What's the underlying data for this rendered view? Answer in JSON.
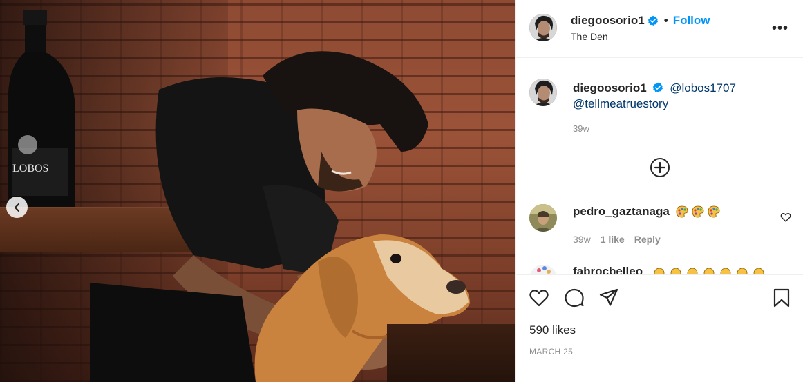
{
  "header": {
    "username": "diegoosorio1",
    "separator": "•",
    "follow_label": "Follow",
    "location": "The Den",
    "more_label": "•••",
    "verified": true
  },
  "photo": {
    "bottle_text": "LOBOS"
  },
  "caption": {
    "username": "diegoosorio1",
    "mention_1": "@lobos1707",
    "mention_2": "@tellmeatruestory",
    "time": "39w"
  },
  "comments": [
    {
      "username": "pedro_gaztanaga",
      "emoji_count": 3,
      "emoji_name": "artist-palette-icon",
      "time": "39w",
      "likes": "1 like",
      "reply_label": "Reply"
    }
  ],
  "partial_comment": {
    "username": "fabrocbelleo"
  },
  "actions": {
    "likes": "590 likes",
    "date": "MARCH 25"
  },
  "colors": {
    "accent": "#0095f6",
    "mention": "#00376b",
    "muted": "#8e8e8e",
    "text": "#262626"
  }
}
